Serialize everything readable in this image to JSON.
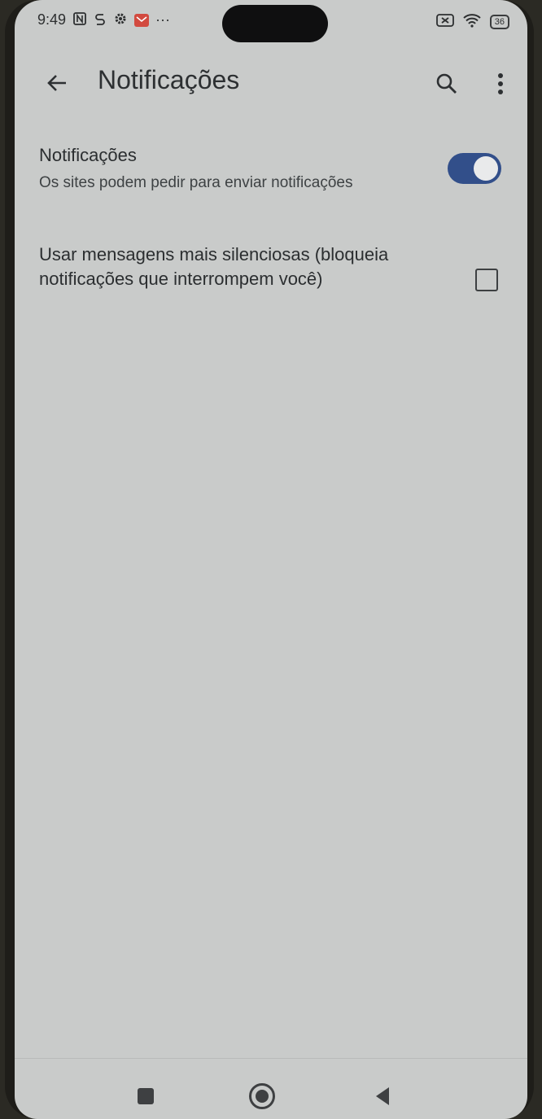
{
  "status_bar": {
    "time": "9:49",
    "icons": [
      "nfc-icon",
      "sync-icon",
      "gear-icon",
      "mail-icon",
      "more-dots-icon"
    ],
    "more": "···",
    "right_icons": [
      "no-sim-icon",
      "wifi-icon",
      "battery-icon"
    ],
    "battery": "36"
  },
  "app_bar": {
    "back_icon": "arrow-left-icon",
    "title": "Notificações",
    "search_icon": "search-icon",
    "menu_icon": "more-vert-icon"
  },
  "settings": [
    {
      "label": "Notificações",
      "summary": "Os sites podem pedir para enviar notificações",
      "control": "toggle",
      "checked": true
    },
    {
      "label": "Usar mensagens mais silenciosas (bloqueia notificações que interrompem você)",
      "control": "checkbox",
      "checked": false
    }
  ],
  "nav_bar": {
    "items": [
      "recents-square-icon",
      "home-circle-icon",
      "back-triangle-icon"
    ]
  },
  "colors": {
    "background": "#c9cbca",
    "toggle_on": "#324f8a",
    "text": "#2b2e30"
  }
}
